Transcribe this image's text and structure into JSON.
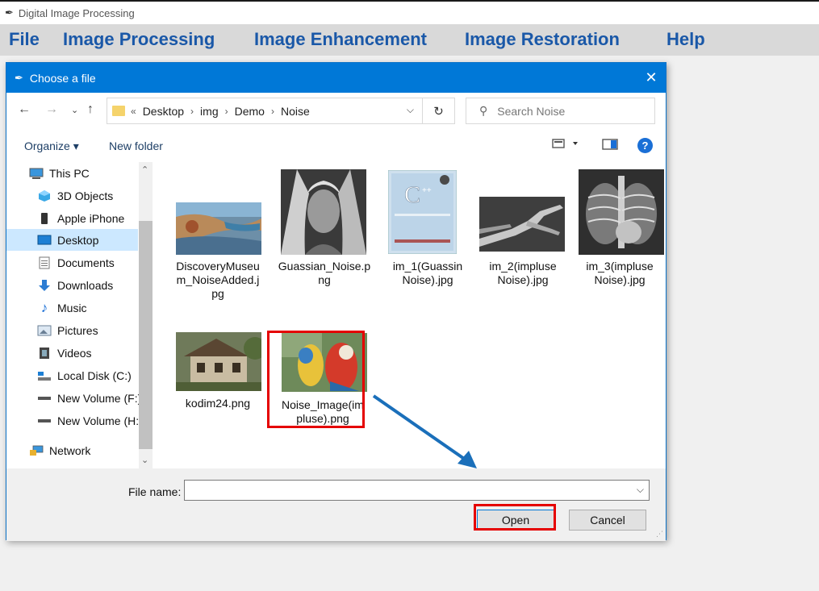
{
  "app": {
    "title": "Digital Image Processing",
    "menu": [
      "File",
      "Image Processing",
      "Image Enhancement",
      "Image Restoration",
      "Help"
    ]
  },
  "dialog": {
    "title": "Choose a file",
    "breadcrumb": [
      "Desktop",
      "img",
      "Demo",
      "Noise"
    ],
    "search_placeholder": "Search Noise",
    "toolbar": {
      "organize": "Organize ▾",
      "new_folder": "New folder"
    },
    "sidebar": [
      "This PC",
      "3D Objects",
      "Apple iPhone",
      "Desktop",
      "Documents",
      "Downloads",
      "Music",
      "Pictures",
      "Videos",
      "Local Disk (C:)",
      "New Volume (F:)",
      "New Volume (H:",
      "Network"
    ],
    "sidebar_selected": "Desktop",
    "files": [
      {
        "name_lines": [
          "DiscoveryMuseu",
          "m_NoiseAdded.j",
          "pg"
        ],
        "icon": "museum-photo-thumbnail"
      },
      {
        "name_lines": [
          "Guassian_Noise.p",
          "ng"
        ],
        "icon": "portrait-photo-thumbnail"
      },
      {
        "name_lines": [
          "im_1(Guassin",
          "Noise).jpg"
        ],
        "icon": "cpp-book-thumbnail"
      },
      {
        "name_lines": [
          "im_2(impluse",
          "Noise).jpg"
        ],
        "icon": "xray-hand-thumbnail"
      },
      {
        "name_lines": [
          "im_3(impluse",
          "Noise).jpg"
        ],
        "icon": "xray-chest-thumbnail"
      },
      {
        "name_lines": [
          "kodim24.png"
        ],
        "icon": "house-photo-thumbnail"
      },
      {
        "name_lines": [
          "Noise_Image(im",
          "pluse).png"
        ],
        "icon": "parrots-photo-thumbnail"
      }
    ],
    "file_name_label": "File name:",
    "file_name_value": "",
    "open_label": "Open",
    "cancel_label": "Cancel"
  },
  "colors": {
    "accent": "#0078d7",
    "menu_text": "#1a58a8",
    "annotation": "#e50000",
    "arrow": "#1a6fba"
  }
}
